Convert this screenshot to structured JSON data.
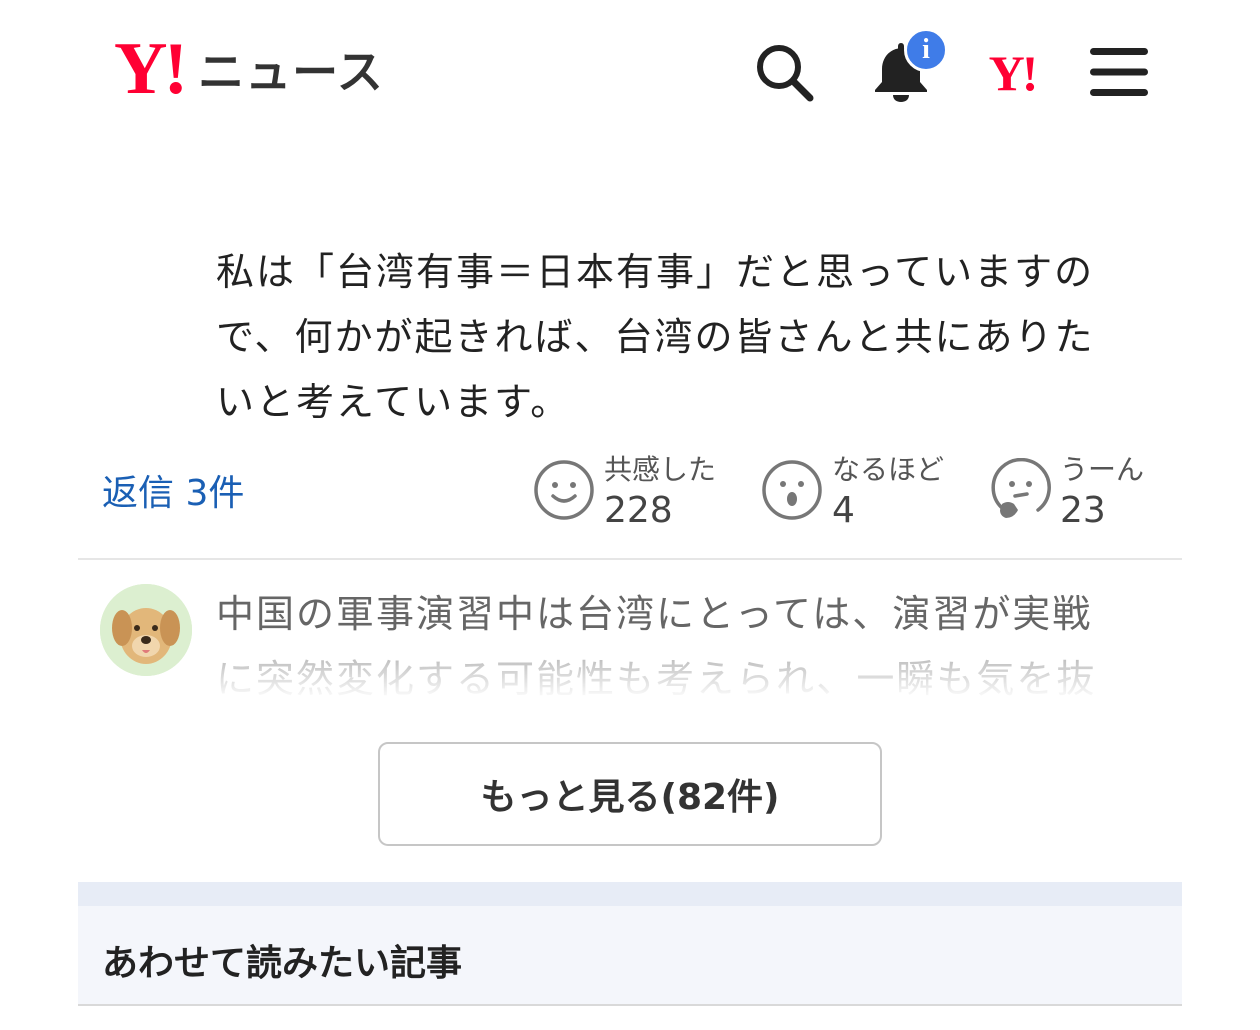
{
  "header": {
    "logo_mark": "Y!",
    "logo_text": "ニュース",
    "search_icon": "search-icon",
    "notification_icon": "bell-icon",
    "notification_badge": "i",
    "yahoo_id_text": "Y!",
    "menu_icon": "hamburger-menu-icon",
    "accent_color": "#ff0033",
    "badge_color": "#3f7ce8"
  },
  "comment": {
    "lines": [
      "私は「台湾有事＝日本有事」だと思っていますの",
      "で、何かが起きれば、台湾の皆さんと共にありた",
      "いと考えています。"
    ],
    "reply_label": "返信 3件",
    "reactions": [
      {
        "icon": "smile-face-icon",
        "label": "共感した",
        "count": "228"
      },
      {
        "icon": "surprised-face-icon",
        "label": "なるほど",
        "count": "4"
      },
      {
        "icon": "thinking-face-icon",
        "label": "うーん",
        "count": "23"
      }
    ]
  },
  "next_comment": {
    "avatar": "dog-avatar",
    "lines": [
      "中国の軍事演習中は台湾にとっては、演習が実戦",
      "に突然変化する可能性も考えられ、一瞬も気を抜"
    ]
  },
  "more_button": {
    "label": "もっと見る(82件)"
  },
  "related": {
    "title": "あわせて読みたい記事"
  }
}
